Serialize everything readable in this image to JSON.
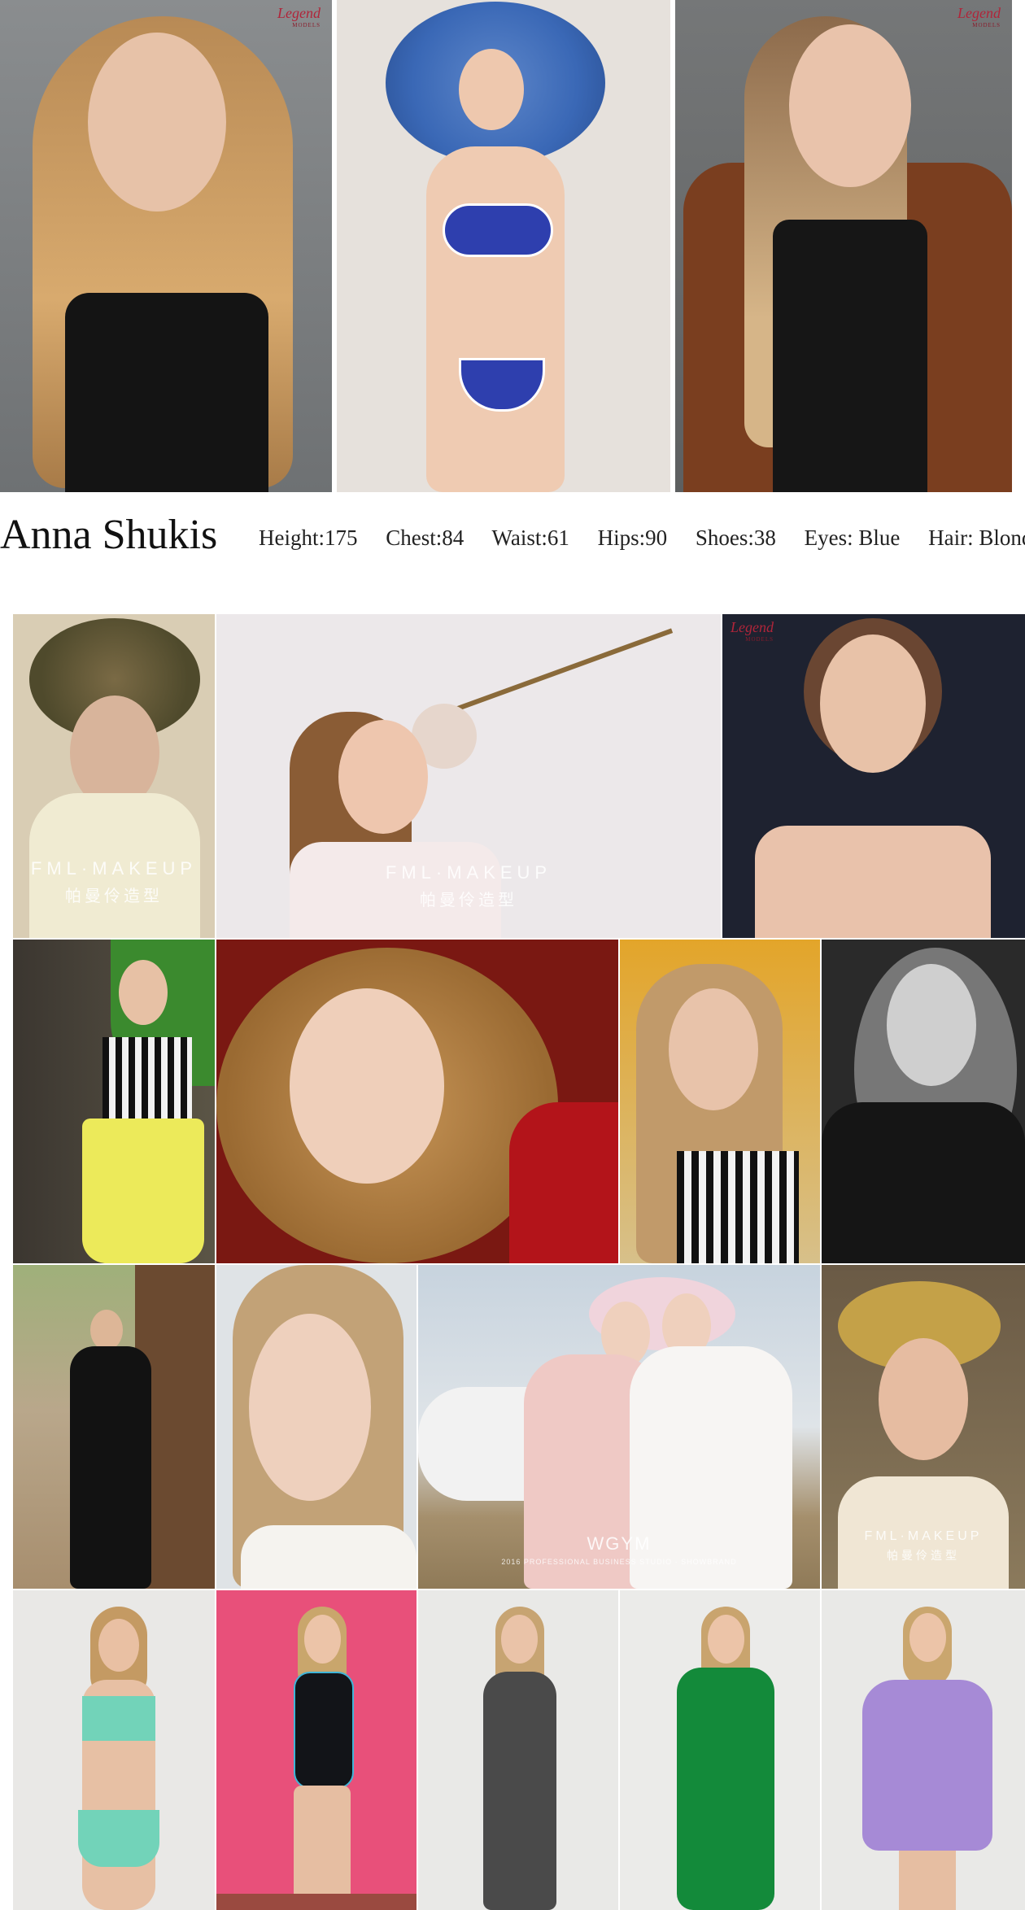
{
  "profile": {
    "name": "Anna Shukis",
    "stats": [
      {
        "label": "Height:",
        "value": "175"
      },
      {
        "label": "Chest:",
        "value": "84"
      },
      {
        "label": "Waist:",
        "value": "61"
      },
      {
        "label": "Hips:",
        "value": "90"
      },
      {
        "label": "Shoes:",
        "value": "38"
      },
      {
        "label": "Eyes:",
        "value": " Blue"
      },
      {
        "label": "Hair:",
        "value": " Blonde"
      }
    ]
  },
  "top_photos": [
    {
      "subject": "portrait-black-top",
      "logo": "Legend",
      "logo_sub": "MODELS"
    },
    {
      "subject": "blue-hat-bikini"
    },
    {
      "subject": "portrait-brown-coat",
      "logo": "Legend",
      "logo_sub": "MODELS"
    }
  ],
  "gallery": {
    "watermarks": {
      "fml_main": "FML·MAKEUP",
      "fml_sub": "帕曼伶造型",
      "wgym_main": "WGYM",
      "wgym_sub": "2016 PROFESSIONAL BUSINESS STUDIO · SHOWBRAND"
    },
    "logo": "Legend",
    "logo_sub": "MODELS"
  },
  "colors": {
    "background": "#ffffff",
    "text": "#111111",
    "logo": "#b0253a"
  }
}
